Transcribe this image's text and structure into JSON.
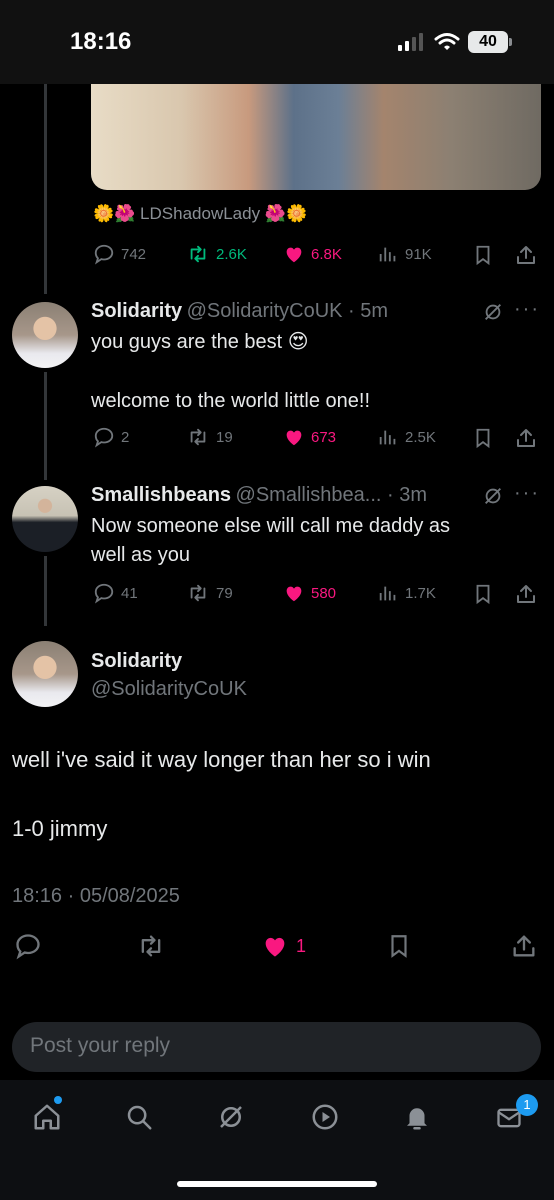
{
  "status_bar": {
    "time": "18:16",
    "battery": "40"
  },
  "tweet_image_caption": "🌼🌺 LDShadowLady 🌺🌼",
  "top_tweet_actions": {
    "replies": "742",
    "reposts": "2.6K",
    "likes": "6.8K",
    "views": "91K"
  },
  "reply1": {
    "name": "Solidarity",
    "handle_time": "@SolidarityCoUK · 5m",
    "line1": "you guys are the best 😍",
    "line2": "welcome to the world little one!!",
    "replies": "2",
    "reposts": "19",
    "likes": "673",
    "views": "2.5K"
  },
  "reply2": {
    "name": "Smallishbeans",
    "handle_time": "@Smallishbea... · 3m",
    "line1": "Now someone else will call me daddy as",
    "line2": "well as you",
    "replies": "41",
    "reposts": "79",
    "likes": "580",
    "views": "1.7K"
  },
  "main_tweet": {
    "name": "Solidarity",
    "handle": "@SolidarityCoUK",
    "line1": "well i've said it way longer than her so i win",
    "line2": "1-0 jimmy",
    "timestamp": "18:16 · 05/08/2025",
    "likes": "1"
  },
  "reply_placeholder": "Post your reply",
  "tabbar": {
    "messages_badge": "1"
  },
  "colors": {
    "like": "#f91880",
    "repost": "#00ba7c",
    "accent": "#1d9bf0",
    "muted": "#71767b"
  }
}
